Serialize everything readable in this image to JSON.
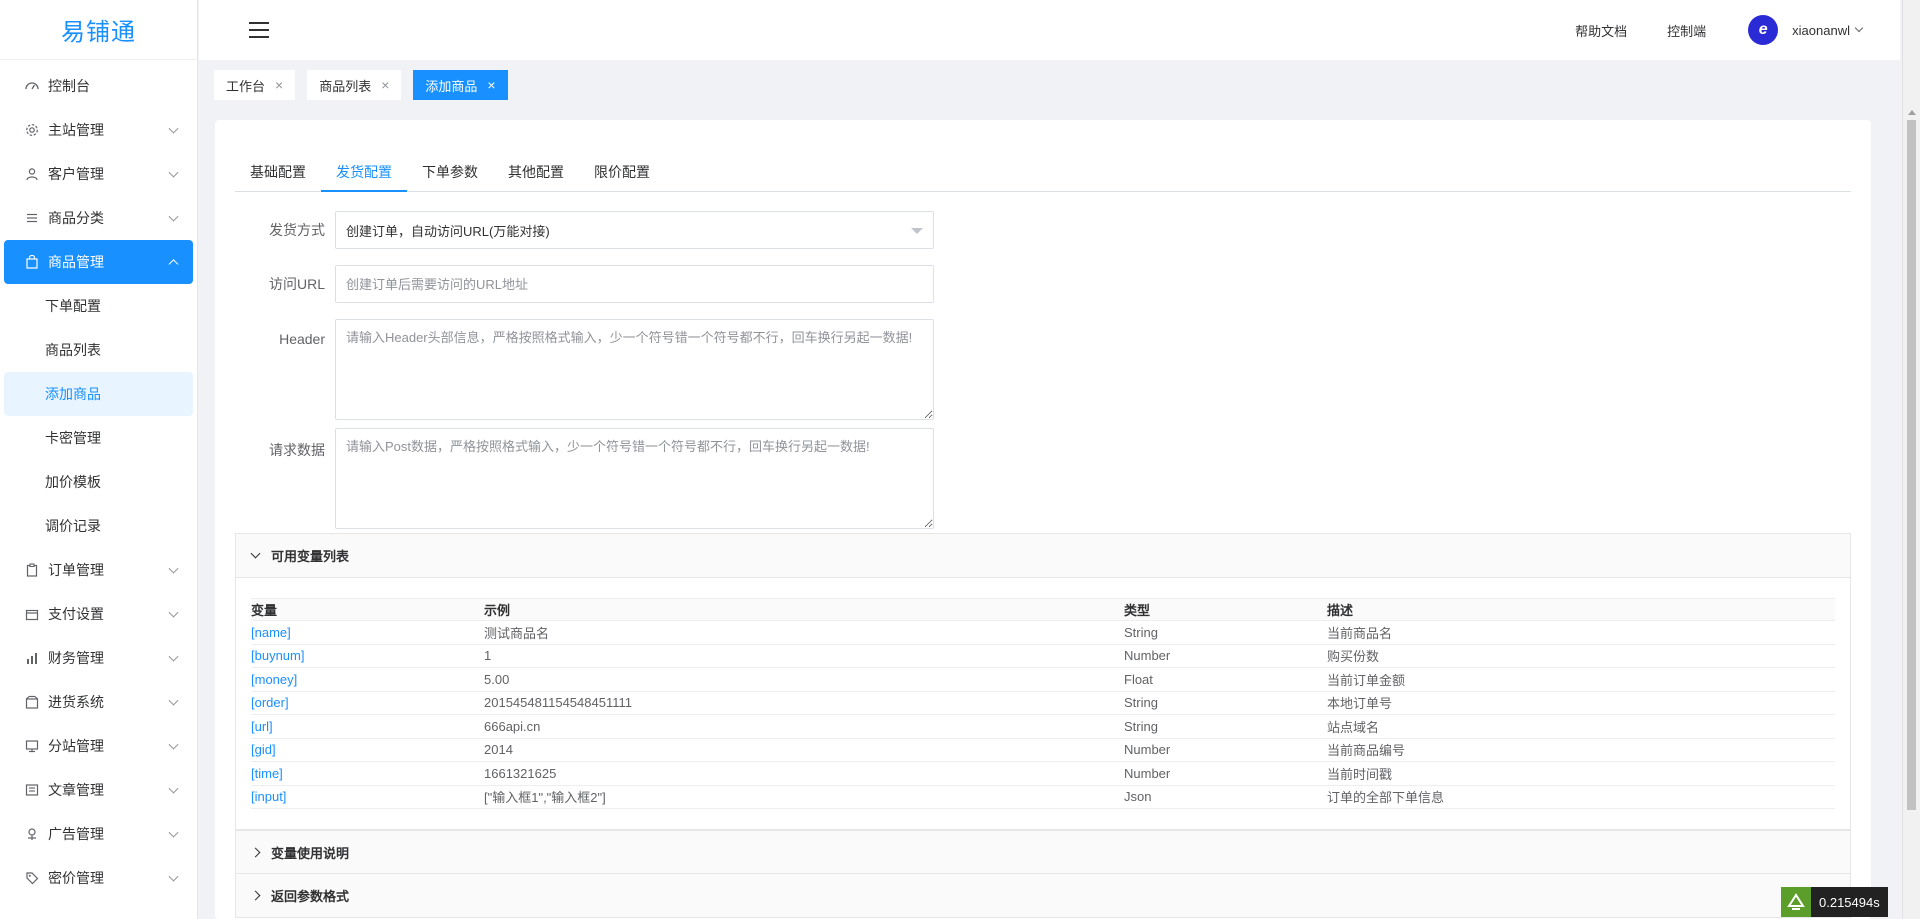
{
  "app": {
    "logo_text": "易铺通"
  },
  "header": {
    "help_docs": "帮助文档",
    "console": "控制端",
    "username": "xiaonanwl",
    "avatar_letter": "e"
  },
  "sidebar": {
    "items": [
      {
        "label": "控制台",
        "icon": "dashboard-icon"
      },
      {
        "label": "主站管理",
        "icon": "gear-icon"
      },
      {
        "label": "客户管理",
        "icon": "user-icon"
      },
      {
        "label": "商品分类",
        "icon": "list-icon"
      },
      {
        "label": "商品管理",
        "icon": "bag-icon"
      },
      {
        "label": "订单管理",
        "icon": "clipboard-icon"
      },
      {
        "label": "支付设置",
        "icon": "wallet-icon"
      },
      {
        "label": "财务管理",
        "icon": "bar-chart-icon"
      },
      {
        "label": "进货系统",
        "icon": "box-icon"
      },
      {
        "label": "分站管理",
        "icon": "monitor-icon"
      },
      {
        "label": "文章管理",
        "icon": "article-icon"
      },
      {
        "label": "广告管理",
        "icon": "megaphone-icon"
      },
      {
        "label": "密价管理",
        "icon": "tag-icon"
      }
    ],
    "submenu": [
      "下单配置",
      "商品列表",
      "添加商品",
      "卡密管理",
      "加价模板",
      "调价记录"
    ]
  },
  "tabs": [
    {
      "label": "工作台"
    },
    {
      "label": "商品列表"
    },
    {
      "label": "添加商品"
    }
  ],
  "content_tabs": [
    "基础配置",
    "发货配置",
    "下单参数",
    "其他配置",
    "限价配置"
  ],
  "form": {
    "ship_method_label": "发货方式",
    "ship_method_value": "创建订单，自动访问URL(万能对接)",
    "url_label": "访问URL",
    "url_placeholder": "创建订单后需要访问的URL地址",
    "header_label": "Header",
    "header_placeholder": "请输入Header头部信息，严格按照格式输入，少一个符号错一个符号都不行，回车换行另起一数据!",
    "post_label": "请求数据",
    "post_placeholder": "请输入Post数据，严格按照格式输入，少一个符号错一个符号都不行，回车换行另起一数据!"
  },
  "variables_panel": {
    "title": "可用变量列表",
    "columns": [
      "变量",
      "示例",
      "类型",
      "描述"
    ],
    "rows": [
      [
        "[name]",
        "测试商品名",
        "String",
        "当前商品名"
      ],
      [
        "[buynum]",
        "1",
        "Number",
        "购买份数"
      ],
      [
        "[money]",
        "5.00",
        "Float",
        "当前订单金额"
      ],
      [
        "[order]",
        "201545481154548451111",
        "String",
        "本地订单号"
      ],
      [
        "[url]",
        "666api.cn",
        "String",
        "站点域名"
      ],
      [
        "[gid]",
        "2014",
        "Number",
        "当前商品编号"
      ],
      [
        "[time]",
        "1661321625",
        "Number",
        "当前时间戳"
      ],
      [
        "[input]",
        "[\"输入框1\",\"输入框2\"]",
        "Json",
        "订单的全部下单信息"
      ]
    ]
  },
  "usage_panel": {
    "title": "变量使用说明"
  },
  "return_panel": {
    "title": "返回参数格式"
  },
  "perf": {
    "time": "0.215494s"
  },
  "colors": {
    "primary": "#1890ff",
    "link": "#1890ff"
  }
}
